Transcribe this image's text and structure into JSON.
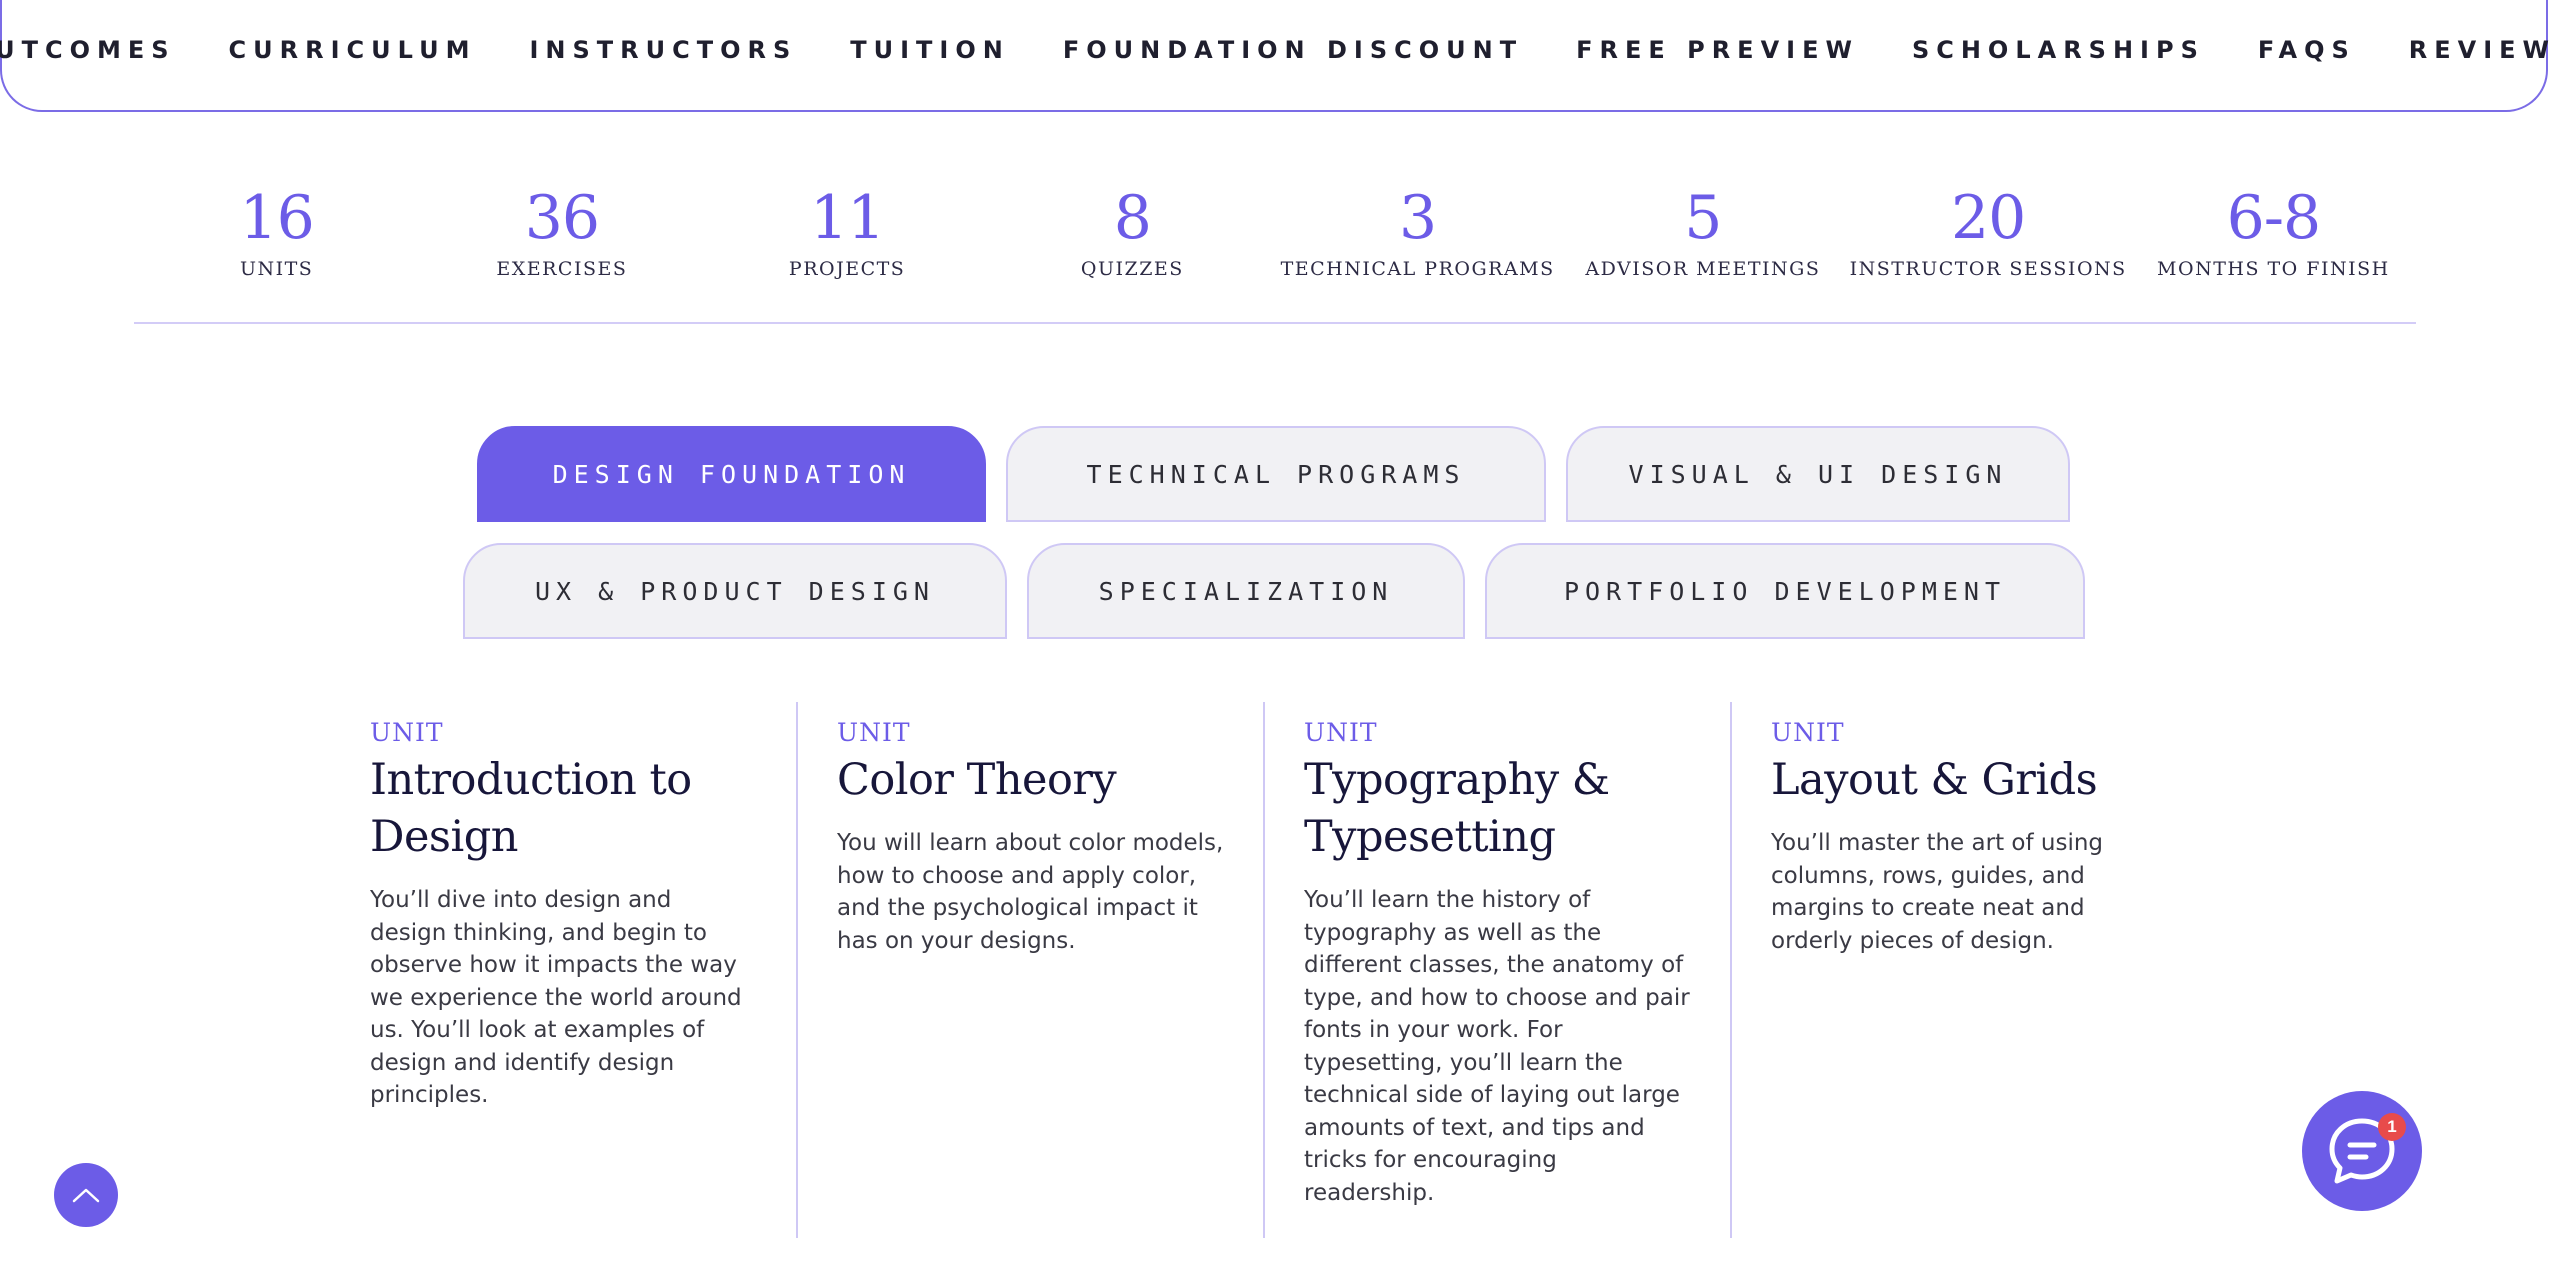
{
  "nav": {
    "items": [
      "OUTCOMES",
      "CURRICULUM",
      "INSTRUCTORS",
      "TUITION",
      "FOUNDATION DISCOUNT",
      "FREE PREVIEW",
      "SCHOLARSHIPS",
      "FAQS",
      "REVIEWS"
    ]
  },
  "stats": [
    {
      "value": "16",
      "label": "UNITS"
    },
    {
      "value": "36",
      "label": "EXERCISES"
    },
    {
      "value": "11",
      "label": "PROJECTS"
    },
    {
      "value": "8",
      "label": "QUIZZES"
    },
    {
      "value": "3",
      "label": "TECHNICAL PROGRAMS"
    },
    {
      "value": "5",
      "label": "ADVISOR MEETINGS"
    },
    {
      "value": "20",
      "label": "INSTRUCTOR SESSIONS"
    },
    {
      "value": "6-8",
      "label": "MONTHS TO FINISH"
    }
  ],
  "tabs": {
    "row1": [
      "DESIGN FOUNDATION",
      "TECHNICAL PROGRAMS",
      "VISUAL & UI DESIGN"
    ],
    "row2": [
      "UX & PRODUCT DESIGN",
      "SPECIALIZATION",
      "PORTFOLIO DEVELOPMENT"
    ],
    "active": "DESIGN FOUNDATION"
  },
  "units": [
    {
      "kicker": "UNIT",
      "title": "Introduction to Design",
      "description": "You’ll dive into design and design thinking, and begin to observe how it impacts the way we experience the world around us. You’ll look at examples of design and identify design principles."
    },
    {
      "kicker": "UNIT",
      "title": "Color Theory",
      "description": "You will learn about color models, how to choose and apply color, and the psychological impact it has on your designs."
    },
    {
      "kicker": "UNIT",
      "title": "Typography & Typesetting",
      "description": "You’ll learn the history of typography as well as the different classes, the anatomy of type, and how to choose and pair fonts in your work. For typesetting, you’ll learn the technical side of laying   out large amounts of text, and tips and tricks for encouraging readership."
    },
    {
      "kicker": "UNIT",
      "title": "Layout & Grids",
      "description": "You’ll master the art of using columns, rows, guides, and margins to create neat and orderly pieces of design."
    }
  ],
  "chat": {
    "badge_count": "1",
    "icon": "chat-bubble-icon"
  },
  "scroll_top": {
    "icon": "chevron-up-icon"
  },
  "colors": {
    "accent": "#6c5ce7",
    "tab_inactive": "#f1f1f4",
    "badge": "#e84b4b",
    "heading": "#17163a"
  }
}
